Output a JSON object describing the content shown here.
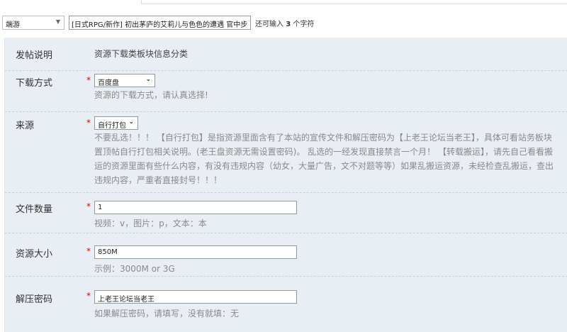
{
  "toolbar": {
    "category_value": "端游",
    "title_value": "[日式RPG/新作] 初出茅庐的艾莉儿与色色的遭遇 官中步",
    "hint_prefix": "还可输入",
    "hint_count": "3",
    "hint_suffix": "个字符"
  },
  "rows": {
    "post_note": {
      "label": "发帖说明",
      "desc": "资源下载类板块信息分类"
    },
    "download_method": {
      "label": "下载方式",
      "value": "百度盘",
      "help": "资源的下载方式，请认真选择!"
    },
    "source": {
      "label": "来源",
      "value": "自行打包",
      "help_lines": [
        "不要乱选！！！ 【自行打包】是指资源里面含有了本站的宣传文件和解压密码为【上老王论坛当老王】，具体可看站务板块",
        "置顶帖自行打包相关说明。(老王盘资源无需设置密码)。 乱选的一经发现直接禁言一个月！ 【转载搬运】，请先自己看看搬",
        "运的资源里面有些什么内容，有没有违规内容（幼女，大量广告，文不对题等等）如果乱搬运资源，未经检查乱搬运，查出",
        "违规内容，严重者直接封号！！！"
      ]
    },
    "file_count": {
      "label": "文件数量",
      "value": "1",
      "help": "视频：v，图片：p，文本：本"
    },
    "size": {
      "label": "资源大小",
      "value": "850M",
      "help": "示例：3000M or 3G"
    },
    "password": {
      "label": "解压密码",
      "value": "上老王论坛当老王",
      "help": "如果解压密码，请填写，没有就填：无"
    }
  },
  "required_mark": "*",
  "icons": {
    "dropdown": "chevron-down-icon"
  },
  "colors": {
    "panel_bg": "#e8eef3",
    "required": "#e60000",
    "help_text": "#8a8a8a"
  }
}
